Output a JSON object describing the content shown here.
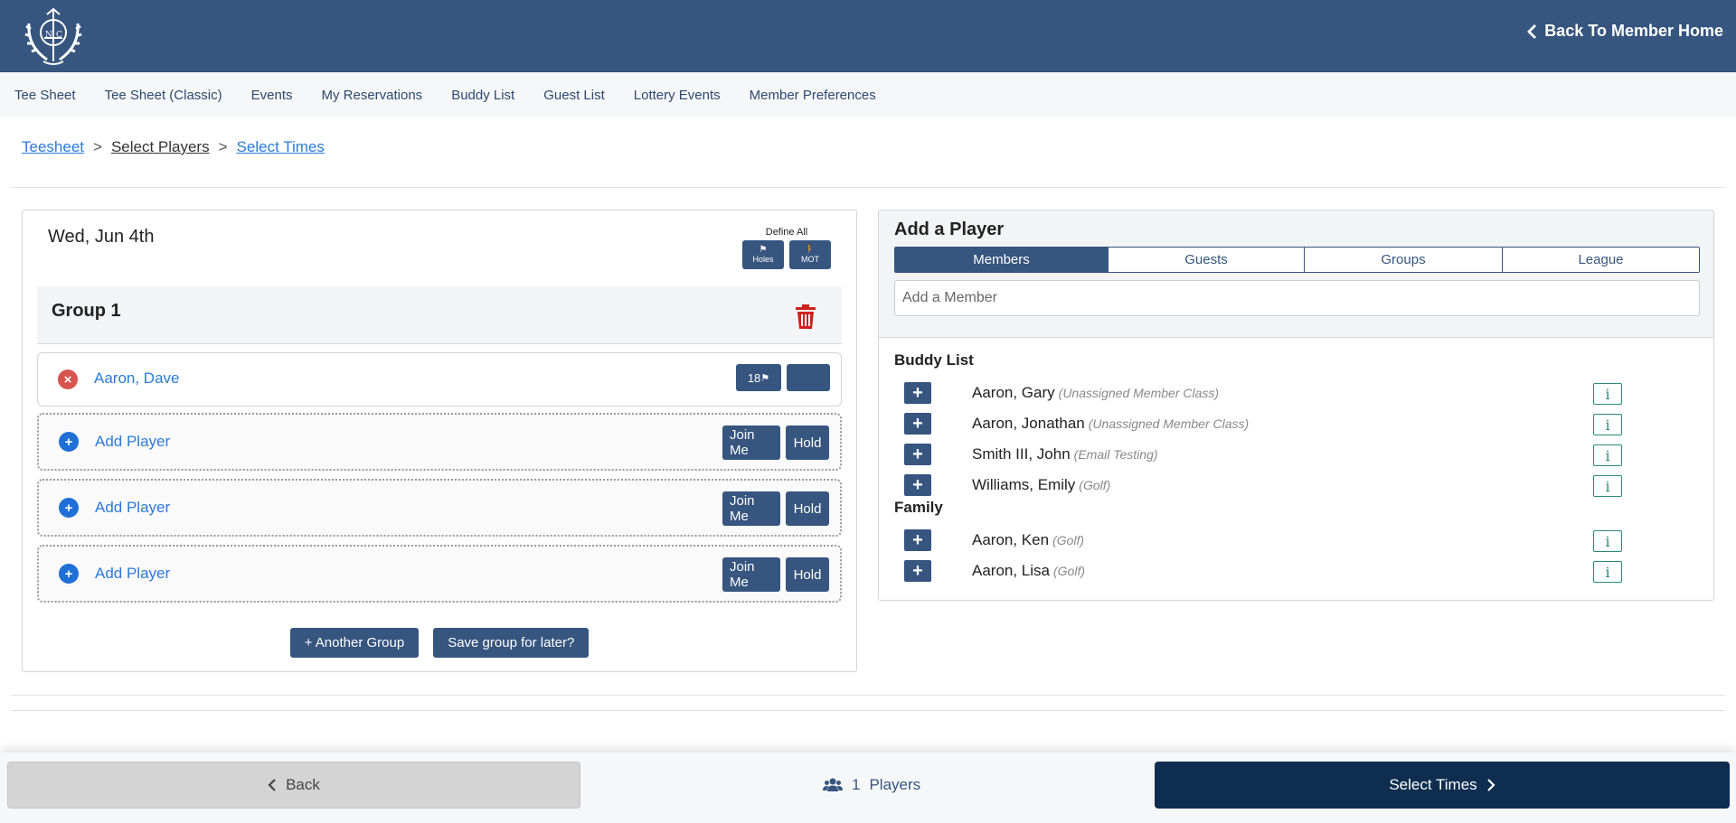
{
  "header": {
    "back_home_label": "Back To Member Home"
  },
  "nav": {
    "items": [
      {
        "label": "Tee Sheet"
      },
      {
        "label": "Tee Sheet (Classic)"
      },
      {
        "label": "Events"
      },
      {
        "label": "My Reservations"
      },
      {
        "label": "Buddy List"
      },
      {
        "label": "Guest List"
      },
      {
        "label": "Lottery Events"
      },
      {
        "label": "Member Preferences"
      }
    ]
  },
  "breadcrumb": {
    "items": [
      {
        "label": "Teesheet"
      },
      {
        "label": "Select Players"
      },
      {
        "label": "Select Times"
      }
    ],
    "separator": ">"
  },
  "group_card": {
    "date": "Wed, Jun 4th",
    "define_all": {
      "title": "Define All",
      "holes_label": "Holes",
      "mot_label": "MOT"
    },
    "group_title": "Group 1",
    "players": [
      {
        "name": "Aaron, Dave",
        "holes": "18"
      }
    ],
    "open_slots": [
      {
        "label": "Add Player",
        "join_label": "Join Me",
        "hold_label": "Hold"
      },
      {
        "label": "Add Player",
        "join_label": "Join Me",
        "hold_label": "Hold"
      },
      {
        "label": "Add Player",
        "join_label": "Join Me",
        "hold_label": "Hold"
      }
    ],
    "another_group_label": "+ Another Group",
    "save_group_label": "Save group for later?"
  },
  "add_player": {
    "title": "Add a Player",
    "tabs": [
      {
        "label": "Members",
        "active": true
      },
      {
        "label": "Guests",
        "active": false
      },
      {
        "label": "Groups",
        "active": false
      },
      {
        "label": "League",
        "active": false
      }
    ],
    "search_placeholder": "Add a Member",
    "buddy_list_title": "Buddy List",
    "buddies": [
      {
        "name": "Aaron, Gary",
        "class": "(Unassigned Member Class)"
      },
      {
        "name": "Aaron, Jonathan",
        "class": "(Unassigned Member Class)"
      },
      {
        "name": "Smith III, John",
        "class": "(Email Testing)"
      },
      {
        "name": "Williams, Emily",
        "class": "(Golf)"
      }
    ],
    "family_title": "Family",
    "family": [
      {
        "name": "Aaron, Ken",
        "class": "(Golf)"
      },
      {
        "name": "Aaron, Lisa",
        "class": "(Golf)"
      }
    ],
    "info_label": "i",
    "plus_label": "+"
  },
  "footer": {
    "back_label": "Back",
    "players_count": "1",
    "players_label": "Players",
    "select_times_label": "Select Times"
  },
  "colors": {
    "header_bg": "#36557f",
    "primary_button": "#36557f",
    "select_times_bg": "#0e2d4f",
    "link": "#2b7ad9",
    "remove_icon": "#d9534f",
    "trash_icon": "#d0201b",
    "info_border": "#2a8a7a"
  },
  "icons": {
    "logo": "club-crest-logo",
    "back_home": "chevron-left-icon",
    "trash": "trash-icon",
    "remove": "remove-circle-icon",
    "add": "add-circle-icon",
    "players": "users-icon"
  }
}
